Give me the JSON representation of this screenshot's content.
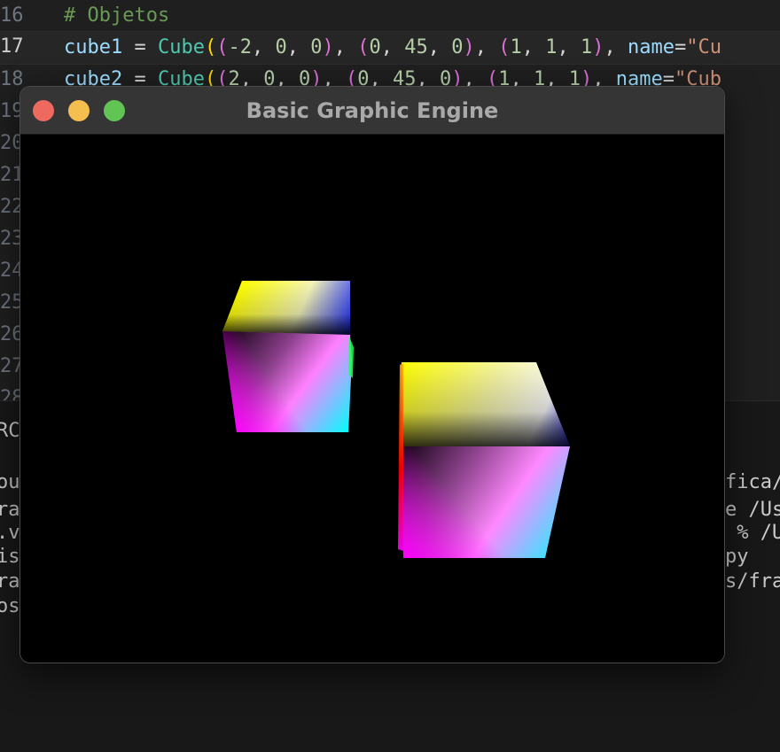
{
  "editor": {
    "lines": [
      {
        "number": "16",
        "tokens": [
          {
            "t": "# Objetos",
            "c": "t-comment"
          }
        ]
      },
      {
        "number": "17",
        "active": true,
        "tokens": [
          {
            "t": "cube1",
            "c": "t-var"
          },
          {
            "t": " = ",
            "c": "t-op"
          },
          {
            "t": "Cube",
            "c": "t-cls"
          },
          {
            "t": "(",
            "c": "t-b1"
          },
          {
            "t": "(",
            "c": "t-b2"
          },
          {
            "t": "-2",
            "c": "t-num"
          },
          {
            "t": ", ",
            "c": "t-op"
          },
          {
            "t": "0",
            "c": "t-num"
          },
          {
            "t": ", ",
            "c": "t-op"
          },
          {
            "t": "0",
            "c": "t-num"
          },
          {
            "t": ")",
            "c": "t-b2"
          },
          {
            "t": ", ",
            "c": "t-op"
          },
          {
            "t": "(",
            "c": "t-b2"
          },
          {
            "t": "0",
            "c": "t-num"
          },
          {
            "t": ", ",
            "c": "t-op"
          },
          {
            "t": "45",
            "c": "t-num"
          },
          {
            "t": ", ",
            "c": "t-op"
          },
          {
            "t": "0",
            "c": "t-num"
          },
          {
            "t": ")",
            "c": "t-b2"
          },
          {
            "t": ", ",
            "c": "t-op"
          },
          {
            "t": "(",
            "c": "t-b2"
          },
          {
            "t": "1",
            "c": "t-num"
          },
          {
            "t": ", ",
            "c": "t-op"
          },
          {
            "t": "1",
            "c": "t-num"
          },
          {
            "t": ", ",
            "c": "t-op"
          },
          {
            "t": "1",
            "c": "t-num"
          },
          {
            "t": ")",
            "c": "t-b2"
          },
          {
            "t": ", ",
            "c": "t-op"
          },
          {
            "t": "name",
            "c": "t-var"
          },
          {
            "t": "=",
            "c": "t-op"
          },
          {
            "t": "\"Cu",
            "c": "t-str"
          }
        ]
      },
      {
        "number": "18",
        "tokens": [
          {
            "t": "cube2",
            "c": "t-var"
          },
          {
            "t": " = ",
            "c": "t-op"
          },
          {
            "t": "Cube",
            "c": "t-cls"
          },
          {
            "t": "(",
            "c": "t-b1"
          },
          {
            "t": "(",
            "c": "t-b2"
          },
          {
            "t": "2",
            "c": "t-num"
          },
          {
            "t": ", ",
            "c": "t-op"
          },
          {
            "t": "0",
            "c": "t-num"
          },
          {
            "t": ", ",
            "c": "t-op"
          },
          {
            "t": "0",
            "c": "t-num"
          },
          {
            "t": ")",
            "c": "t-b2"
          },
          {
            "t": ", ",
            "c": "t-op"
          },
          {
            "t": "(",
            "c": "t-b2"
          },
          {
            "t": "0",
            "c": "t-num"
          },
          {
            "t": ", ",
            "c": "t-op"
          },
          {
            "t": "45",
            "c": "t-num"
          },
          {
            "t": ", ",
            "c": "t-op"
          },
          {
            "t": "0",
            "c": "t-num"
          },
          {
            "t": ")",
            "c": "t-b2"
          },
          {
            "t": ", ",
            "c": "t-op"
          },
          {
            "t": "(",
            "c": "t-b2"
          },
          {
            "t": "1",
            "c": "t-num"
          },
          {
            "t": ", ",
            "c": "t-op"
          },
          {
            "t": "1",
            "c": "t-num"
          },
          {
            "t": ", ",
            "c": "t-op"
          },
          {
            "t": "1",
            "c": "t-num"
          },
          {
            "t": ")",
            "c": "t-b2"
          },
          {
            "t": ", ",
            "c": "t-op"
          },
          {
            "t": "name",
            "c": "t-var"
          },
          {
            "t": "=",
            "c": "t-op"
          },
          {
            "t": "\"Cub",
            "c": "t-str"
          }
        ]
      },
      {
        "number": "19",
        "tokens": []
      },
      {
        "number": "20",
        "tokens": []
      },
      {
        "number": "21",
        "tokens": []
      },
      {
        "number": "22",
        "tokens": []
      },
      {
        "number": "23",
        "tokens": []
      },
      {
        "number": "24",
        "tokens": []
      },
      {
        "number": "25",
        "tokens": []
      },
      {
        "number": "26",
        "tokens": []
      },
      {
        "number": "27",
        "tokens": []
      },
      {
        "number": "28",
        "tokens": []
      }
    ]
  },
  "terminal": {
    "left_fragments": [
      "RC",
      "",
      "ou",
      "ra",
      ".v",
      "is",
      "ra",
      "os"
    ],
    "right_fragments": [
      "fica/",
      "e /Us",
      " % /U",
      "py",
      "s/fra"
    ]
  },
  "window": {
    "title": "Basic Graphic Engine",
    "controls": {
      "close_color": "#ee6a5e",
      "minimize_color": "#f5bf4f",
      "maximize_color": "#61c454"
    },
    "viewport": {
      "background": "#000000",
      "objects": [
        "cube1",
        "cube2"
      ]
    }
  }
}
